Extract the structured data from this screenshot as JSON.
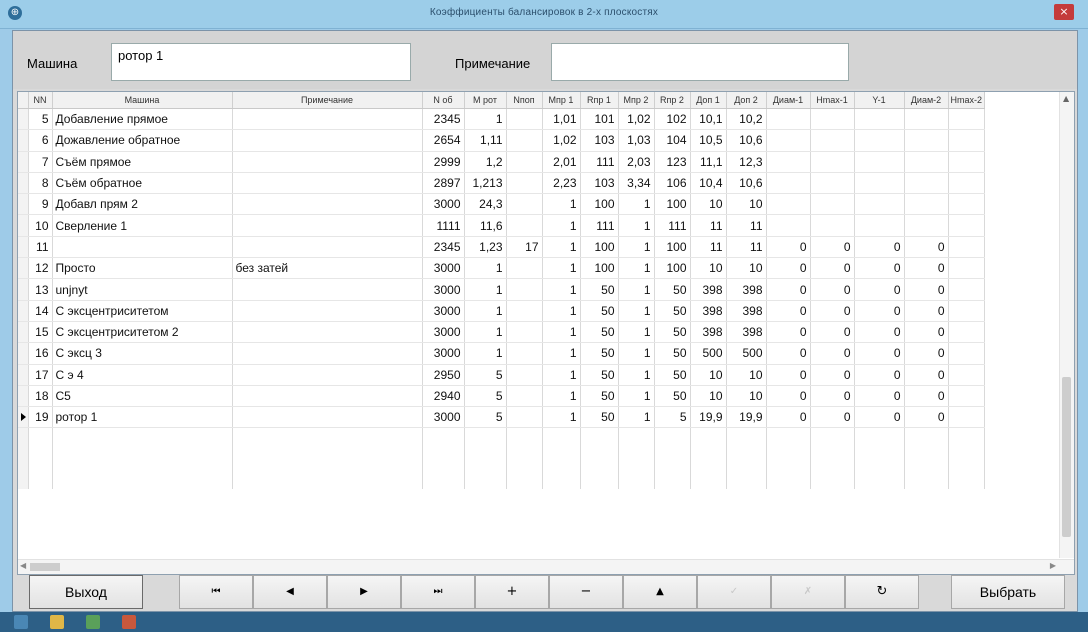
{
  "window": {
    "title": "Коэффициенты балансировок в 2-х плоскостях",
    "title_icon": "app-icon",
    "close_glyph": "×"
  },
  "header": {
    "machine_label": "Машина",
    "machine_value": "ротор 1",
    "note_label": "Примечание",
    "note_value": ""
  },
  "grid": {
    "columns": [
      "NN",
      "Машина",
      "Примечание",
      "N об",
      "M рот",
      "Nпоп",
      "Mпр 1",
      "Rпр 1",
      "Mпр 2",
      "Rпр 2",
      "Доп 1",
      "Доп 2",
      "Диам-1",
      "Hmax-1",
      "Y-1",
      "Диам-2",
      "Hmax-2"
    ],
    "rows": [
      {
        "nn": "5",
        "machine": "Добавление прямое",
        "note": "",
        "n": "2345",
        "m": "1",
        "npop": "",
        "mp1": "1,01",
        "rp1": "101",
        "mp2": "1,02",
        "rp2": "102",
        "d1": "10,1",
        "d2": "10,2",
        "diam1": "",
        "hmax1": "",
        "y1": "",
        "diam2": "",
        "hmax2": ""
      },
      {
        "nn": "6",
        "machine": "Дожавление обратное",
        "note": "",
        "n": "2654",
        "m": "1,11",
        "npop": "",
        "mp1": "1,02",
        "rp1": "103",
        "mp2": "1,03",
        "rp2": "104",
        "d1": "10,5",
        "d2": "10,6",
        "diam1": "",
        "hmax1": "",
        "y1": "",
        "diam2": "",
        "hmax2": ""
      },
      {
        "nn": "7",
        "machine": "Съём прямое",
        "note": "",
        "n": "2999",
        "m": "1,2",
        "npop": "",
        "mp1": "2,01",
        "rp1": "111",
        "mp2": "2,03",
        "rp2": "123",
        "d1": "11,1",
        "d2": "12,3",
        "diam1": "",
        "hmax1": "",
        "y1": "",
        "diam2": "",
        "hmax2": ""
      },
      {
        "nn": "8",
        "machine": "Съём обратное",
        "note": "",
        "n": "2897",
        "m": "1,213",
        "npop": "",
        "mp1": "2,23",
        "rp1": "103",
        "mp2": "3,34",
        "rp2": "106",
        "d1": "10,4",
        "d2": "10,6",
        "diam1": "",
        "hmax1": "",
        "y1": "",
        "diam2": "",
        "hmax2": ""
      },
      {
        "nn": "9",
        "machine": "Добавл прям 2",
        "note": "",
        "n": "3000",
        "m": "24,3",
        "npop": "",
        "mp1": "1",
        "rp1": "100",
        "mp2": "1",
        "rp2": "100",
        "d1": "10",
        "d2": "10",
        "diam1": "",
        "hmax1": "",
        "y1": "",
        "diam2": "",
        "hmax2": ""
      },
      {
        "nn": "10",
        "machine": "Сверление 1",
        "note": "",
        "n": "1111",
        "m": "11,6",
        "npop": "",
        "mp1": "1",
        "rp1": "111",
        "mp2": "1",
        "rp2": "111",
        "d1": "11",
        "d2": "11",
        "diam1": "",
        "hmax1": "",
        "y1": "",
        "diam2": "",
        "hmax2": ""
      },
      {
        "nn": "11",
        "machine": "",
        "note": "",
        "n": "2345",
        "m": "1,23",
        "npop": "17",
        "mp1": "1",
        "rp1": "100",
        "mp2": "1",
        "rp2": "100",
        "d1": "11",
        "d2": "11",
        "diam1": "0",
        "hmax1": "0",
        "y1": "0",
        "diam2": "0",
        "hmax2": ""
      },
      {
        "nn": "12",
        "machine": "Просто",
        "note": "без затей",
        "n": "3000",
        "m": "1",
        "npop": "",
        "mp1": "1",
        "rp1": "100",
        "mp2": "1",
        "rp2": "100",
        "d1": "10",
        "d2": "10",
        "diam1": "0",
        "hmax1": "0",
        "y1": "0",
        "diam2": "0",
        "hmax2": ""
      },
      {
        "nn": "13",
        "machine": "unjnyt",
        "note": "",
        "n": "3000",
        "m": "1",
        "npop": "",
        "mp1": "1",
        "rp1": "50",
        "mp2": "1",
        "rp2": "50",
        "d1": "398",
        "d2": "398",
        "diam1": "0",
        "hmax1": "0",
        "y1": "0",
        "diam2": "0",
        "hmax2": ""
      },
      {
        "nn": "14",
        "machine": "С эксцентриситетом",
        "note": "",
        "n": "3000",
        "m": "1",
        "npop": "",
        "mp1": "1",
        "rp1": "50",
        "mp2": "1",
        "rp2": "50",
        "d1": "398",
        "d2": "398",
        "diam1": "0",
        "hmax1": "0",
        "y1": "0",
        "diam2": "0",
        "hmax2": ""
      },
      {
        "nn": "15",
        "machine": "С эксцентриситетом 2",
        "note": "",
        "n": "3000",
        "m": "1",
        "npop": "",
        "mp1": "1",
        "rp1": "50",
        "mp2": "1",
        "rp2": "50",
        "d1": "398",
        "d2": "398",
        "diam1": "0",
        "hmax1": "0",
        "y1": "0",
        "diam2": "0",
        "hmax2": ""
      },
      {
        "nn": "16",
        "machine": "С эксц 3",
        "note": "",
        "n": "3000",
        "m": "1",
        "npop": "",
        "mp1": "1",
        "rp1": "50",
        "mp2": "1",
        "rp2": "50",
        "d1": "500",
        "d2": "500",
        "diam1": "0",
        "hmax1": "0",
        "y1": "0",
        "diam2": "0",
        "hmax2": ""
      },
      {
        "nn": "17",
        "machine": "С э 4",
        "note": "",
        "n": "2950",
        "m": "5",
        "npop": "",
        "mp1": "1",
        "rp1": "50",
        "mp2": "1",
        "rp2": "50",
        "d1": "10",
        "d2": "10",
        "diam1": "0",
        "hmax1": "0",
        "y1": "0",
        "diam2": "0",
        "hmax2": ""
      },
      {
        "nn": "18",
        "machine": "С5",
        "note": "",
        "n": "2940",
        "m": "5",
        "npop": "",
        "mp1": "1",
        "rp1": "50",
        "mp2": "1",
        "rp2": "50",
        "d1": "10",
        "d2": "10",
        "diam1": "0",
        "hmax1": "0",
        "y1": "0",
        "diam2": "0",
        "hmax2": ""
      },
      {
        "nn": "19",
        "machine": "ротор 1",
        "note": "",
        "n": "3000",
        "m": "5",
        "npop": "",
        "mp1": "1",
        "rp1": "50",
        "mp2": "1",
        "rp2": "5",
        "d1": "19,9",
        "d2": "19,9",
        "diam1": "0",
        "hmax1": "0",
        "y1": "0",
        "diam2": "0",
        "hmax2": "",
        "current": true
      }
    ]
  },
  "buttons": {
    "exit": "Выход",
    "first": "⏮",
    "prev": "◀",
    "next": "▶",
    "last": "⏭",
    "add": "+",
    "delete": "−",
    "edit": "▲",
    "post": "✓",
    "cancel": "✗",
    "refresh": "↻",
    "select": "Выбрать"
  }
}
